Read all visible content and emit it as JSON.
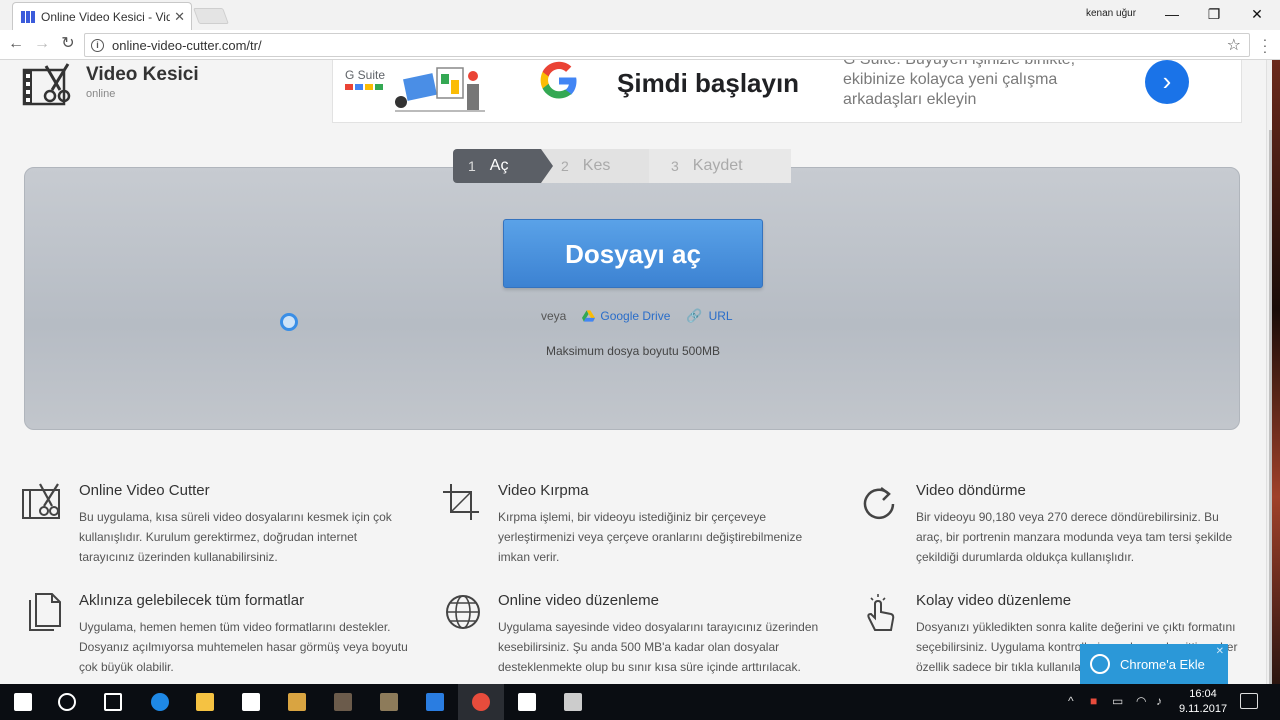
{
  "browser": {
    "tab_title": "Online Video Kesici - Vid",
    "url": "online-video-cutter.com/tr/",
    "user_name": "kenan uğur",
    "minimize": "—",
    "maximize": "❐",
    "close": "✕"
  },
  "site": {
    "logo_title": "Video Kesici",
    "logo_sub": "online"
  },
  "ad": {
    "brand": "G Suite",
    "headline": "Şimdi başlayın",
    "body": "G Suite: Büyüyen işinizle birlikte, ekibinize kolayca yeni çalışma arkadaşları ekleyin",
    "arrow": "›"
  },
  "steps": [
    {
      "num": "1",
      "label": "Aç"
    },
    {
      "num": "2",
      "label": "Kes"
    },
    {
      "num": "3",
      "label": "Kaydet"
    }
  ],
  "upload": {
    "open_button": "Dosyayı aç",
    "or_text": "veya",
    "google_drive": "Google Drive",
    "url_link": "URL",
    "max_size": "Maksimum dosya boyutu 500MB"
  },
  "features": [
    {
      "title": "Online Video Cutter",
      "desc": "Bu uygulama, kısa süreli video dosyalarını kesmek için çok kullanışlıdır. Kurulum gerektirmez, doğrudan internet tarayıcınız üzerinden kullanabilirsiniz.",
      "icon": "film-cut-icon"
    },
    {
      "title": "Video Kırpma",
      "desc": "Kırpma işlemi, bir videoyu istediğiniz bir çerçeveye yerleştirmenizi veya çerçeve oranlarını değiştirebilmenize imkan verir.",
      "icon": "crop-icon"
    },
    {
      "title": "Video döndürme",
      "desc": "Bir videoyu 90,180 veya 270 derece döndürebilirsiniz. Bu araç, bir portrenin manzara modunda veya tam tersi şekilde çekildiği durumlarda oldukça kullanışlıdır.",
      "icon": "rotate-icon"
    },
    {
      "title": "Aklınıza gelebilecek tüm formatlar",
      "desc": "Uygulama, hemen hemen tüm video formatlarını destekler. Dosyanız açılmıyorsa muhtemelen hasar görmüş veya boyutu çok büyük olabilir.",
      "icon": "documents-icon"
    },
    {
      "title": "Online video düzenleme",
      "desc": "Uygulama sayesinde video dosyalarını tarayıcınız üzerinden kesebilirsiniz. Şu anda 500 MB'a kadar olan dosyalar desteklenmekte olup bu sınır kısa süre içinde arttırılacak.",
      "icon": "globe-icon"
    },
    {
      "title": "Kolay video düzenleme",
      "desc": "Dosyanızı yükledikten sonra kalite değerini ve çıktı formatını seçebilirsiniz. Uygulama kontrolleri son derece basittir — her özellik sadece bir tıkla kullanılabilir.",
      "icon": "touch-icon"
    }
  ],
  "chrome_ext": {
    "label": "Chrome'a Ekle",
    "close": "✕"
  },
  "taskbar": {
    "time": "16:04",
    "date": "9.11.2017",
    "apps": [
      {
        "name": "start-icon",
        "color": "#ffffff"
      },
      {
        "name": "search-icon",
        "color": "#ffffff"
      },
      {
        "name": "task-view-icon",
        "color": "#ffffff"
      },
      {
        "name": "edge-icon",
        "color": "#1e88e5"
      },
      {
        "name": "file-explorer-icon",
        "color": "#f5c242"
      },
      {
        "name": "store-icon",
        "color": "#ffffff"
      },
      {
        "name": "app-icon-1",
        "color": "#d9a441"
      },
      {
        "name": "app-icon-2",
        "color": "#6b5b4b"
      },
      {
        "name": "app-icon-3",
        "color": "#8d7b5a"
      },
      {
        "name": "app-icon-4",
        "color": "#2a7de1"
      },
      {
        "name": "chrome-icon",
        "color": "#e74c3c"
      },
      {
        "name": "mail-icon",
        "color": "#ffffff"
      },
      {
        "name": "app-icon-5",
        "color": "#cccccc"
      }
    ]
  }
}
